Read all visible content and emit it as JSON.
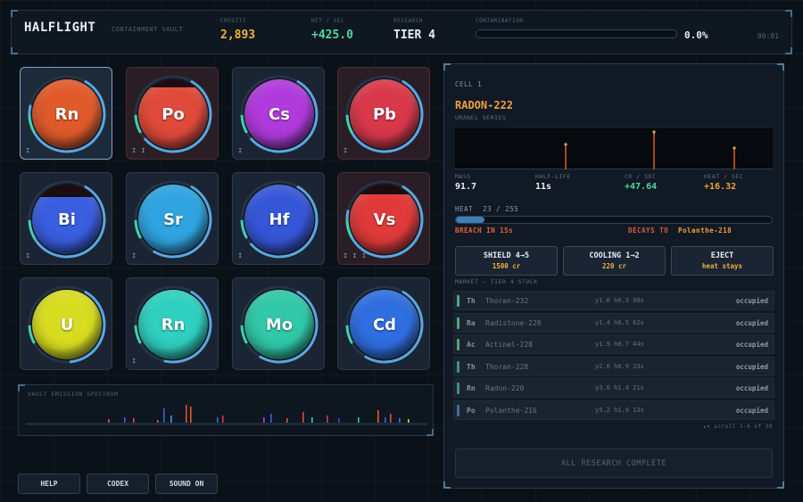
{
  "header": {
    "title": "HALFLIGHT",
    "subtitle": "CONTAINMENT VAULT",
    "credits_label": "CREDITS",
    "credits": "2,893",
    "net_label": "NET / SEC",
    "net": "+425.0",
    "research_label": "RESEARCH",
    "research": "TIER 4",
    "contam_label": "CONTAMINATION",
    "contam": "0.0%",
    "contam_fraction": 0.0,
    "timer": "00:01"
  },
  "cells": [
    {
      "symbol": "Rn",
      "color": "#e05a2a",
      "ring": 0.7,
      "level": "I",
      "selected": true,
      "warn": false,
      "fill_top": 0
    },
    {
      "symbol": "Po",
      "color": "#e04a3a",
      "ring": 0.55,
      "level": "I I",
      "selected": false,
      "warn": true,
      "fill_top": 0.12
    },
    {
      "symbol": "Cs",
      "color": "#b03adc",
      "ring": 0.55,
      "level": "I",
      "selected": false,
      "warn": false,
      "fill_top": 0
    },
    {
      "symbol": "Pb",
      "color": "#d8384a",
      "ring": 0.6,
      "level": "I",
      "selected": false,
      "warn": true,
      "fill_top": 0
    },
    {
      "symbol": "Bi",
      "color": "#3a5ee0",
      "ring": 0.6,
      "level": "I",
      "selected": false,
      "warn": false,
      "fill_top": 0.18
    },
    {
      "symbol": "Sr",
      "color": "#2fa4e0",
      "ring": 0.5,
      "level": "I",
      "selected": false,
      "warn": false,
      "fill_top": 0
    },
    {
      "symbol": "Hf",
      "color": "#3656d8",
      "ring": 0.55,
      "level": "I",
      "selected": false,
      "warn": false,
      "fill_top": 0
    },
    {
      "symbol": "Vs",
      "color": "#e03a3a",
      "ring": 0.7,
      "level": "I I I",
      "selected": false,
      "warn": true,
      "fill_top": 0.14
    },
    {
      "symbol": "U",
      "color": "#d8dc20",
      "ring": 0.4,
      "level": "",
      "selected": false,
      "warn": false,
      "fill_top": 0
    },
    {
      "symbol": "Rn",
      "color": "#2fd0c0",
      "ring": 0.45,
      "level": "I",
      "selected": false,
      "warn": false,
      "fill_top": 0
    },
    {
      "symbol": "Mo",
      "color": "#30c8a8",
      "ring": 0.5,
      "level": "",
      "selected": false,
      "warn": false,
      "fill_top": 0
    },
    {
      "symbol": "Cd",
      "color": "#2f6ee0",
      "ring": 0.5,
      "level": "",
      "selected": false,
      "warn": false,
      "fill_top": 0
    }
  ],
  "spectrum": {
    "label": "VAULT EMISSION SPECTRUM"
  },
  "buttons": {
    "help": "HELP",
    "codex": "CODEX",
    "sound": "SOUND ON"
  },
  "panel": {
    "cell_label": "CELL 1",
    "isotope": "RADON-222",
    "series": "URANEL SERIES",
    "mass_label": "MASS",
    "mass": "91.7",
    "halflife_label": "HALF-LIFE",
    "halflife": "11s",
    "cr_label": "CR / SEC",
    "cr": "+47.64",
    "heat_sec_label": "HEAT / SEC",
    "heat_sec": "+16.32",
    "heat_label": "HEAT",
    "heat_value": "23 / 255",
    "heat_fraction": 0.09,
    "breach": "BREACH IN 15s",
    "decays_to_label": "DECAYS TO",
    "decays_to": "Polanthe-218",
    "actions": [
      {
        "title": "SHIELD 4→5",
        "cost": "1500 cr"
      },
      {
        "title": "COOLING 1→2",
        "cost": "220 cr"
      },
      {
        "title": "EJECT",
        "cost": "heat stays"
      }
    ],
    "market_label": "MARKET  —  TIER 4 STOCK",
    "market": [
      {
        "sym": "Th",
        "name": "Thoran-232",
        "stats": "y1.0  h0.3  90s",
        "status": "occupied",
        "color": "#5aa07a"
      },
      {
        "sym": "Ra",
        "name": "Radistone-228",
        "stats": "y1.4  h0.5  62s",
        "status": "occupied",
        "color": "#5aa07a"
      },
      {
        "sym": "Ac",
        "name": "Actinel-228",
        "stats": "y1.9  h0.7  44s",
        "status": "occupied",
        "color": "#5aa07a"
      },
      {
        "sym": "Th",
        "name": "Thoran-228",
        "stats": "y2.6  h0.9  33s",
        "status": "occupied",
        "color": "#4a8a8a"
      },
      {
        "sym": "Rn",
        "name": "Radon-220",
        "stats": "y3.6  h1.4  21s",
        "status": "occupied",
        "color": "#4a8a8a"
      },
      {
        "sym": "Po",
        "name": "Polanthe-216",
        "stats": "y5.2  h1.9  13s",
        "status": "occupied",
        "color": "#4a6a9a"
      }
    ],
    "scroll_hint": "▴▾ scroll  1-6 of 39",
    "research_complete": "ALL RESEARCH COMPLETE"
  }
}
